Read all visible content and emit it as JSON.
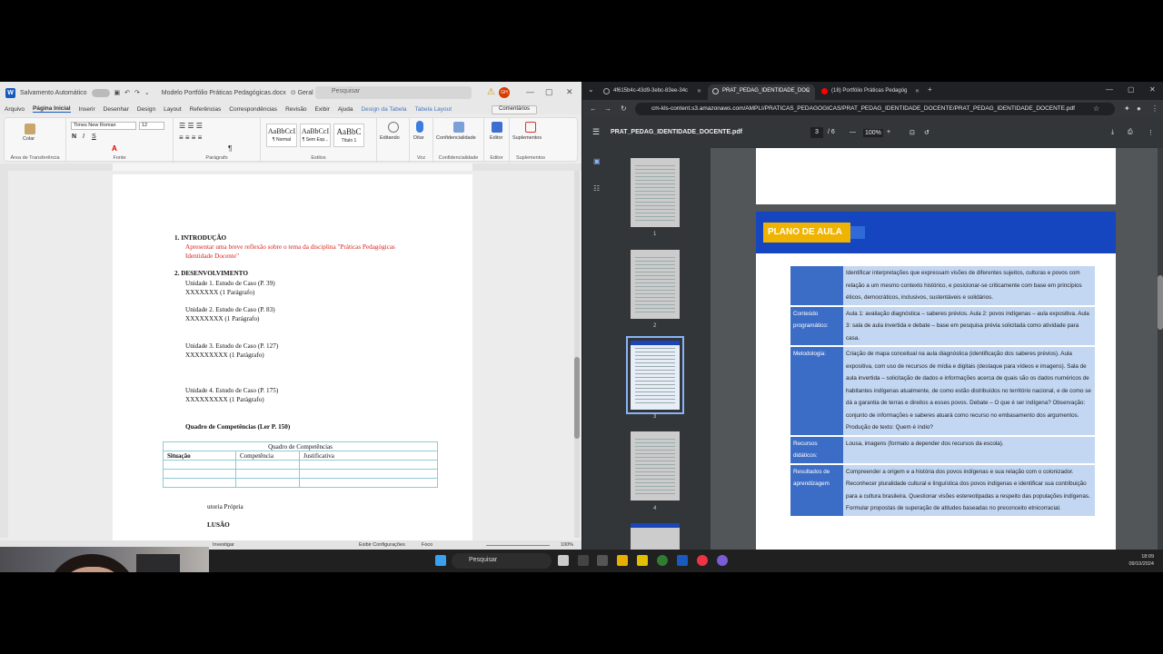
{
  "word": {
    "autosave_label": "Salvamento Automático",
    "doc_title": "Modelo Portfólio Práticas Pedagógicas.docx",
    "sensitivity": "Geral",
    "search_placeholder": "Pesquisar",
    "avatar_initials": "GH",
    "menu": [
      "Arquivo",
      "Página Inicial",
      "Inserir",
      "Desenhar",
      "Design",
      "Layout",
      "Referências",
      "Correspondências",
      "Revisão",
      "Exibir",
      "Ajuda",
      "Design da Tabela",
      "Tabela Layout"
    ],
    "comments_label": "Comentários",
    "font_name": "Times New Roman",
    "font_size": "12",
    "paste_label": "Colar",
    "styles": [
      {
        "preview": "AaBbCcI",
        "name": "¶ Normal"
      },
      {
        "preview": "AaBbCcI",
        "name": "¶ Sem Esp..."
      },
      {
        "preview": "AaBbC",
        "name": "Título 1"
      }
    ],
    "ribbon_buttons": [
      "Editando",
      "Ditar",
      "Confidencialidade",
      "Editor",
      "Suplementos"
    ],
    "group_labels": [
      "Área de Transferência",
      "Fonte",
      "Parágrafo",
      "Estilos",
      "Voz",
      "Confidencialidade",
      "Editor",
      "Suplementos"
    ],
    "doc": {
      "intro_heading": "1.   INTRODUÇÃO",
      "intro_text_1": "Apresentar uma breve reflexão sobre o tema da disciplina \"Práticas Pedagógicas",
      "intro_text_2": "Identidade Docente\"",
      "dev_heading": "2.   DESENVOLVIMENTO",
      "u1": "Unidade 1. Estudo de Caso (P. 39)",
      "u1x": "XXXXXXX (1 Parágrafo)",
      "u2": "Unidade 2. Estudo de Caso (P. 83)",
      "u2x": "XXXXXXXX (1 Parágrafo)",
      "u3": "Unidade 3. Estudo de Caso (P. 127)",
      "u3x": "XXXXXXXXX (1 Parágrafo)",
      "u4": "Unidade 4. Estudo de Caso (P. 175)",
      "u4x": "XXXXXXXXX (1 Parágrafo)",
      "comp_heading": "Quadro de Competências (Ler P. 150)",
      "table_caption": "Quadro de Competências",
      "table_headers": [
        "Situação",
        "Competência",
        "Justificativa"
      ],
      "autoria": "utoria Própria",
      "conclusao": "LUSÃO"
    },
    "status": {
      "investigar": "Investigar",
      "config": "Exibir Configurações",
      "foco": "Foco",
      "zoom": "100%"
    }
  },
  "chrome": {
    "tabs": [
      {
        "title": "4f615b4c-43d9-3ebc-83ee-34c",
        "active": false
      },
      {
        "title": "PRAT_PEDAG_IDENTIDADE_DOC",
        "active": true
      },
      {
        "title": "(18) Portfólio Práticas Pedagóg",
        "active": false
      }
    ],
    "url": "cm-kls-content.s3.amazonaws.com/AMPLI/PRATICAS_PEDAGOGICAS/PRAT_PEDAG_IDENTIDADE_DOCENTE/PRAT_PEDAG_IDENTIDADE_DOCENTE.pdf",
    "pdf_name": "PRAT_PEDAG_IDENTIDADE_DOCENTE.pdf",
    "page_current": "3",
    "page_total": "/   6",
    "zoom": "100%",
    "thumbs": [
      "1",
      "2",
      "3",
      "4"
    ],
    "banner": "PLANO DE AULA",
    "rows": [
      {
        "k": "",
        "v": "Identificar interpretações que expressam visões de diferentes sujeitos, culturas e povos com relação a um mesmo contexto histórico, e posicionar-se criticamente com base em princípios éticos, democráticos, inclusivos, sustentáveis e solidários."
      },
      {
        "k": "Conteúdo programático:",
        "v": "Aula 1: avaliação diagnóstica – saberes prévios. Aula 2: povos indígenas – aula expositiva. Aula 3: sala de aula invertida e debate – base em pesquisa prévia solicitada como atividade para casa."
      },
      {
        "k": "Metodologia:",
        "v": "Criação de mapa conceitual na aula diagnóstica (identificação dos saberes prévios). Aula expositiva, com uso de recursos de mídia e digitais (destaque para vídeos e imagens). Sala de aula invertida – solicitação de dados e informações acerca de quais são os dados numéricos de habitantes indígenas atualmente, de como estão distribuídos no território nacional, e de como se dá a garantia de terras e direitos a esses povos. Debate – O que é ser indígena? Observação: conjunto de informações e saberes atuará como recurso no embasamento dos argumentos. Produção de texto: Quem é índio?"
      },
      {
        "k": "Recursos didáticos:",
        "v": "Lousa, imagens (formato a depender dos recursos da escola)."
      },
      {
        "k": "Resultados de aprendizagem",
        "v": "Compreender a origem e a história dos povos indígenas e sua relação com o colonizador. Reconhecer pluralidade cultural e linguística dos povos indígenas e identificar sua contribuição para a cultura brasileira. Questionar visões estereotipadas a respeito das populações indígenas. Formular propostas de superação de atitudes baseadas no preconceito etnicorracial."
      }
    ]
  },
  "taskbar": {
    "search": "Pesquisar",
    "time": "18:09",
    "date": "09/10/2024"
  }
}
